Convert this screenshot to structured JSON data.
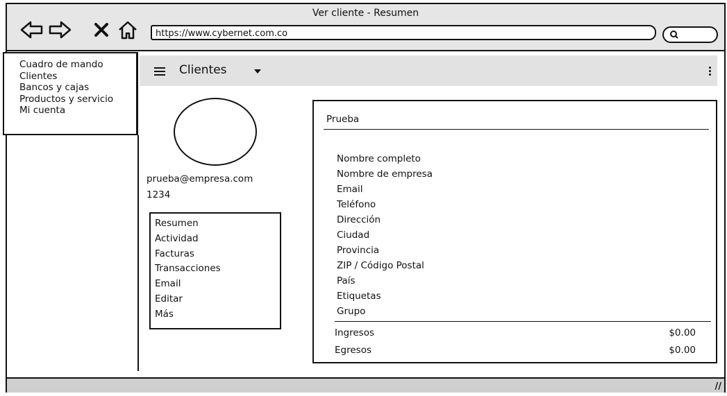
{
  "window": {
    "title": "Ver cliente - Resumen",
    "url": "https://www.cybernet.com.co"
  },
  "nav_icons": [
    "back-arrow-icon",
    "forward-arrow-icon",
    "close-icon",
    "home-icon"
  ],
  "side_menu": {
    "items": [
      {
        "label": "Cuadro de mando"
      },
      {
        "label": "Clientes"
      },
      {
        "label": "Bancos y cajas"
      },
      {
        "label": "Productos y servicio"
      },
      {
        "label": "Mi cuenta"
      }
    ]
  },
  "toolbar": {
    "title": "Clientes"
  },
  "profile": {
    "email": "prueba@empresa.com",
    "id": "1234"
  },
  "tabs": {
    "items": [
      {
        "label": "Resumen"
      },
      {
        "label": "Actividad"
      },
      {
        "label": "Facturas"
      },
      {
        "label": "Transacciones"
      },
      {
        "label": "Email"
      },
      {
        "label": "Editar"
      },
      {
        "label": "Más"
      }
    ]
  },
  "panel": {
    "title": "Prueba",
    "fields": [
      "Nombre completo",
      "Nombre de empresa",
      "Email",
      "Teléfono",
      "Dirección",
      "Ciudad",
      "Provincia",
      "ZIP / Código Postal",
      "País",
      "Etiquetas",
      "Grupo"
    ],
    "totals": [
      {
        "label": "Ingresos",
        "value": "$0.00"
      },
      {
        "label": "Egresos",
        "value": "$0.00"
      }
    ]
  }
}
